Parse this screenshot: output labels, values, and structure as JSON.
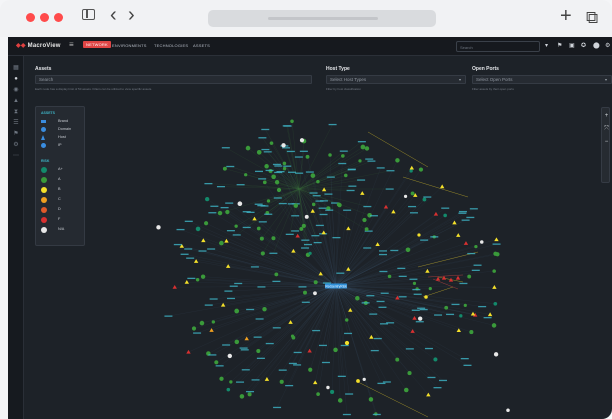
{
  "browser": {
    "controls": [
      "close-dot",
      "minimize-dot",
      "zoom-dot"
    ],
    "icons": {
      "sidebar": "sidebar-toggle-icon",
      "back": "‹",
      "forward": "›",
      "new_tab": "+",
      "tabs": "⧉"
    }
  },
  "app": {
    "brand": "MacroView",
    "brand_mark": "◆◆",
    "nav": [
      {
        "label": "NETWORK",
        "active": true
      },
      {
        "label": "ENVIRONMENTS",
        "active": false
      },
      {
        "label": "TECHNOLOGIES",
        "active": false
      },
      {
        "label": "ASSETS",
        "active": false
      }
    ],
    "top_search_placeholder": "Search",
    "top_icons": [
      "▾",
      "⚑",
      "▣",
      "✪",
      "⬤",
      "⚙"
    ],
    "sidebar_icons": [
      "▦",
      "●",
      "◉",
      "▲",
      "⧗",
      "☰",
      "⚑",
      "⚙",
      "⋯"
    ]
  },
  "filters": {
    "assets": {
      "label": "Assets",
      "placeholder": "Search",
      "help": "Each node has a display limit of 50 assets. Filters can be utilized to view specific assets."
    },
    "host_type": {
      "label": "Host Type",
      "placeholder": "Select Host Types",
      "help": "Filter by host classification"
    },
    "open_ports": {
      "label": "Open Ports",
      "placeholder": "Select Open Ports",
      "help": "Filter assets by their open ports"
    }
  },
  "legend": {
    "section1_title": "ASSETS",
    "items": [
      {
        "label": "Brand",
        "shape": "rect",
        "color": "#3a8de0"
      },
      {
        "label": "Domain",
        "shape": "circle",
        "color": "#3a8de0"
      },
      {
        "label": "Host",
        "shape": "triangle",
        "color": "#3a8de0"
      },
      {
        "label": "IP",
        "shape": "circle",
        "color": "#3a8de0"
      }
    ],
    "section2_title": "RISK",
    "risk": [
      {
        "label": "A+",
        "color": "#138a6b"
      },
      {
        "label": "A",
        "color": "#3a9a3a"
      },
      {
        "label": "B",
        "color": "#f4e02a"
      },
      {
        "label": "C",
        "color": "#f0a020"
      },
      {
        "label": "D",
        "color": "#e05a2a"
      },
      {
        "label": "F",
        "color": "#d83030"
      },
      {
        "label": "N/A",
        "color": "#e8e8e8"
      }
    ]
  },
  "graph": {
    "center_label": "RedsentryRisk",
    "zoom_controls": [
      "+",
      "⤧",
      "−"
    ]
  },
  "colors": {
    "accent": "#e04545",
    "edge": "#4a6f8e",
    "edge_green": "#3a6e3a",
    "edge_yellow": "#b8a428",
    "edge_red": "#c04040",
    "center": "#2f8fd8",
    "label_cyan": "#3fb6c8"
  }
}
